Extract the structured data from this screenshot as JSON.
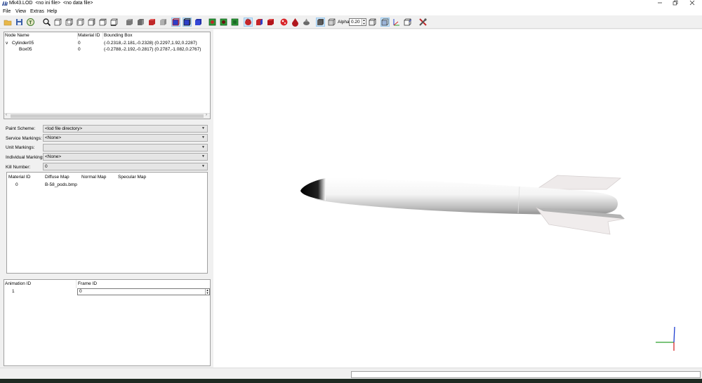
{
  "window": {
    "title": "Mk43.LOD  <no ini file>  <no data file>",
    "controls": [
      "minimize",
      "restore",
      "close"
    ]
  },
  "menu": [
    "File",
    "View",
    "Extras",
    "Help"
  ],
  "toolbar": {
    "alpha_label": "Alpha:",
    "alpha_value": "0.20"
  },
  "node_tree": {
    "columns": [
      "Node Name",
      "Material ID",
      "Bounding Box"
    ],
    "rows": [
      {
        "expander": "v",
        "name": "Cylinder05",
        "material": "0",
        "bbox": "(-0.2318,-2.181,-0.2328) (0.2297,1.92,0.2287)"
      },
      {
        "expander": "",
        "name": "Box05",
        "material": "0",
        "bbox": "(-0.2788,-2.192,-0.2817) (0.2787,-1.082,0.2767)"
      }
    ]
  },
  "fields": [
    {
      "label": "Paint Scheme:",
      "value": "<lod file directory>"
    },
    {
      "label": "Service Markings:",
      "value": "<None>"
    },
    {
      "label": "Unit Markings:",
      "value": ""
    },
    {
      "label": "Individual Markings:",
      "value": "<None>"
    },
    {
      "label": "Kill Number:",
      "value": "0"
    }
  ],
  "material_table": {
    "columns": [
      "Material ID",
      "Diffuse Map",
      "Normal Map",
      "Specular Map"
    ],
    "rows": [
      {
        "material": "0",
        "diffuse": "B-58_pods.bmp",
        "normal": "",
        "specular": ""
      }
    ]
  },
  "animation": {
    "columns": [
      "Animation ID",
      "Frame ID"
    ],
    "rows": [
      {
        "id": "1",
        "frame": "0"
      }
    ]
  },
  "colors": {
    "accent": "#0078d7",
    "toolbar_active": "#cce4f7",
    "axis_x": "#2ca02c",
    "axis_y": "#1f3fd1",
    "axis_z": "#d62728"
  }
}
